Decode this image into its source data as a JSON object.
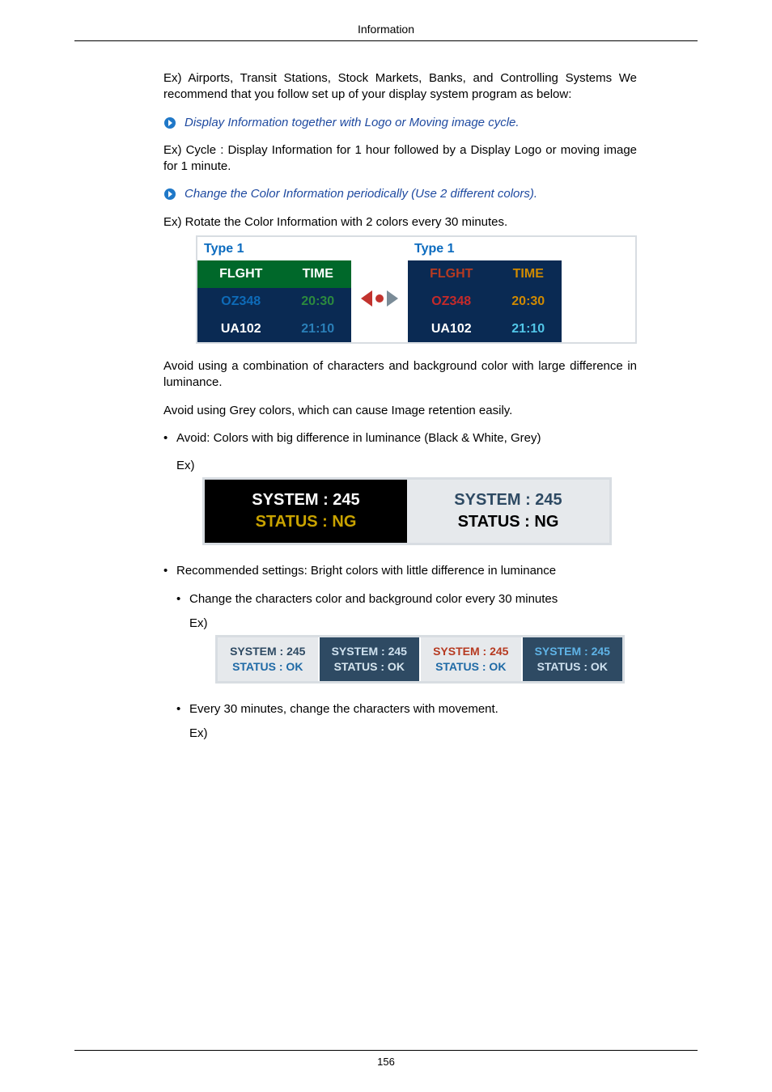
{
  "header": {
    "section_title": "Information"
  },
  "body": {
    "p1": "Ex) Airports, Transit Stations, Stock Markets, Banks, and Controlling Systems We recommend that you follow set up of your display system program as below:",
    "tip1": "Display Information together with Logo or Moving image cycle.",
    "p2": "Ex) Cycle : Display Information for 1 hour followed by a Display Logo or moving image for 1 minute.",
    "tip2": "Change the Color Information periodically (Use 2 different colors).",
    "p3": "Ex) Rotate the Color Information with 2 colors every 30 minutes.",
    "p4": "Avoid using a combination of characters and background color with large difference in luminance.",
    "p5": "Avoid using Grey colors, which can cause Image retention easily.",
    "li_avoid": "Avoid: Colors with big difference in luminance (Black & White, Grey)",
    "ex_label": "Ex)",
    "li_recommended": "Recommended settings: Bright colors with little difference in luminance",
    "li_change30": "Change the characters color and background color every 30 minutes",
    "li_move30": "Every 30 minutes, change the characters with movement."
  },
  "fig1": {
    "type_label_a": "Type 1",
    "type_label_b": "Type 1",
    "headers": {
      "c1": "FLGHT",
      "c2": "TIME"
    },
    "rows": [
      {
        "c1": "OZ348",
        "c2": "20:30"
      },
      {
        "c1": "UA102",
        "c2": "21:10"
      }
    ]
  },
  "fig2": {
    "a": {
      "l1": "SYSTEM : 245",
      "l2": "STATUS : NG"
    },
    "b": {
      "l1": "SYSTEM : 245",
      "l2": "STATUS : NG"
    }
  },
  "fig3": {
    "cells": [
      {
        "l1": "SYSTEM : 245",
        "l2": "STATUS : OK"
      },
      {
        "l1": "SYSTEM : 245",
        "l2": "STATUS : OK"
      },
      {
        "l1": "SYSTEM : 245",
        "l2": "STATUS : OK"
      },
      {
        "l1": "SYSTEM : 245",
        "l2": "STATUS : OK"
      }
    ]
  },
  "footer": {
    "page_number": "156"
  }
}
